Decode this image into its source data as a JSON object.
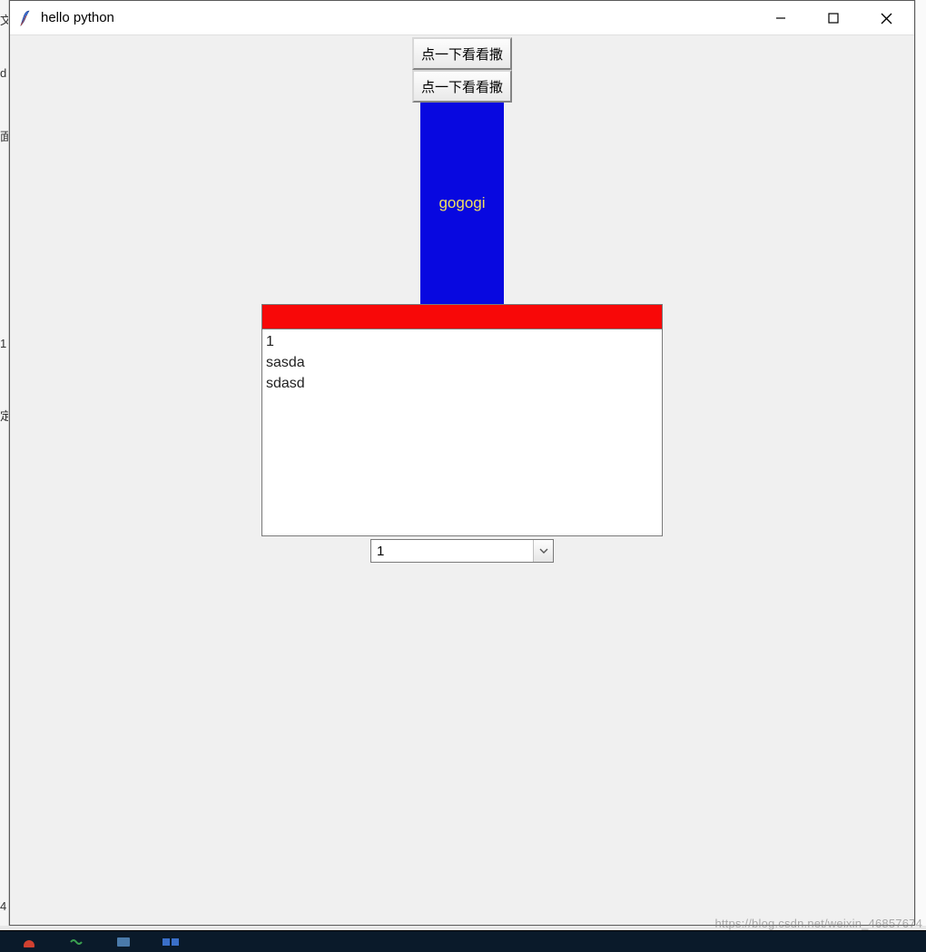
{
  "window": {
    "title": "hello python"
  },
  "buttons": {
    "btn1_label": "点一下看看撒",
    "btn2_label": "点一下看看撒"
  },
  "label": {
    "text": "gogogi"
  },
  "entry": {
    "value": ""
  },
  "textarea": {
    "value": "1\nsasda\nsdasd"
  },
  "combobox": {
    "selected": "1",
    "options": [
      "1"
    ]
  },
  "watermark": "https://blog.csdn.net/weixin_46857674",
  "colors": {
    "label_bg": "#0808e0",
    "label_fg": "#f0e060",
    "entry_bg": "#f80808",
    "window_bg": "#f0f0f0"
  }
}
